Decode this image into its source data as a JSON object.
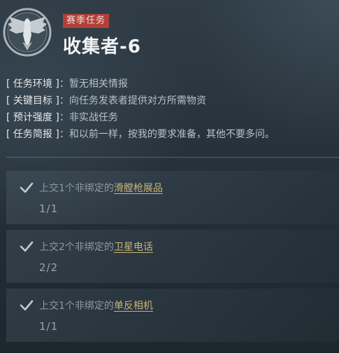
{
  "header": {
    "emblem_icon": "eagle-emblem-icon",
    "season_tag": "赛季任务",
    "title": "收集者-6"
  },
  "info": [
    {
      "key": "[ 任务环境 ]",
      "value": "：暂无相关情报"
    },
    {
      "key": "[ 关键目标 ]",
      "value": "：向任务发表者提供对方所需物资"
    },
    {
      "key": "[ 预计强度 ]",
      "value": "：非实战任务"
    },
    {
      "key": "[ 任务简报 ]",
      "value": "：和以前一样，按我的要求准备，其他不要多问。"
    }
  ],
  "objectives": [
    {
      "status_icon": "checkmark-icon",
      "prefix": "上交1个非绑定的",
      "item": "滑膛枪展品",
      "progress": "1/1"
    },
    {
      "status_icon": "checkmark-icon",
      "prefix": "上交2个非绑定的",
      "item": "卫星电话",
      "progress": "2/2"
    },
    {
      "status_icon": "checkmark-icon",
      "prefix": "上交1个非绑定的",
      "item": "单反相机",
      "progress": "1/1"
    }
  ],
  "colors": {
    "season_tag_bg": "#b0413a",
    "item_link": "#c9b47a",
    "completed_text": "#8e989f"
  }
}
